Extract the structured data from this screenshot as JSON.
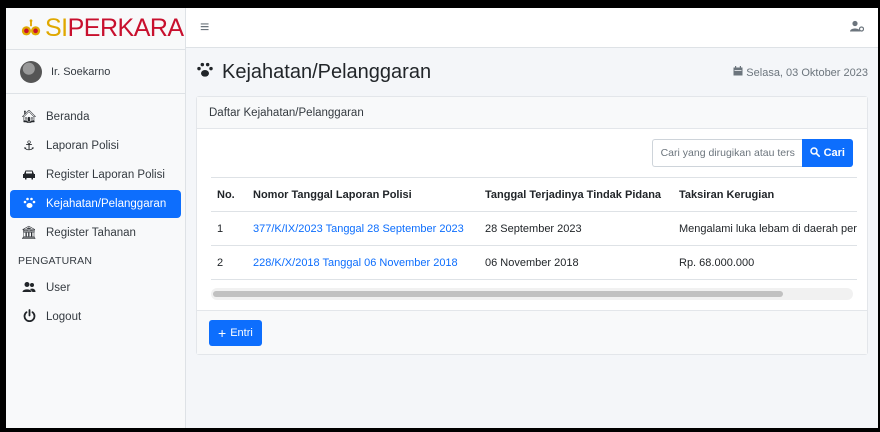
{
  "brand": {
    "prefix": "SI",
    "name": "PERKARA"
  },
  "user": {
    "name": "Ir. Soekarno"
  },
  "sidebar": {
    "items": [
      {
        "label": "Beranda",
        "icon": "home-icon"
      },
      {
        "label": "Laporan Polisi",
        "icon": "anchor-icon"
      },
      {
        "label": "Register Laporan Polisi",
        "icon": "car-icon"
      },
      {
        "label": "Kejahatan/Pelanggaran",
        "icon": "paw-icon",
        "active": true
      },
      {
        "label": "Register Tahanan",
        "icon": "building-icon"
      }
    ],
    "section_header": "PENGATURAN",
    "settings": [
      {
        "label": "User",
        "icon": "users-icon"
      },
      {
        "label": "Logout",
        "icon": "power-icon"
      }
    ]
  },
  "header": {
    "title": "Kejahatan/Pelanggaran",
    "date": "Selasa, 03 Oktober 2023"
  },
  "card": {
    "title": "Daftar Kejahatan/Pelanggaran",
    "search_placeholder": "Cari yang dirugikan atau ters",
    "search_label": "Cari",
    "columns": [
      "No.",
      "Nomor Tanggal Laporan Polisi",
      "Tanggal Terjadinya Tindak Pidana",
      "Taksiran Kerugian"
    ],
    "rows": [
      {
        "no": "1",
        "laporan": "377/K/IX/2023 Tanggal 28 September 2023",
        "tanggal": "28 September 2023",
        "kerugian": "Mengalami luka lebam di daerah peru"
      },
      {
        "no": "2",
        "laporan": "228/K/X/2018 Tanggal 06 November 2018",
        "tanggal": "06 November 2018",
        "kerugian": "Rp. 68.000.000"
      }
    ],
    "entri_label": "Entri"
  },
  "colors": {
    "primary": "#0d6efd",
    "brand_red": "#c8102e",
    "brand_gold": "#e0a800"
  }
}
